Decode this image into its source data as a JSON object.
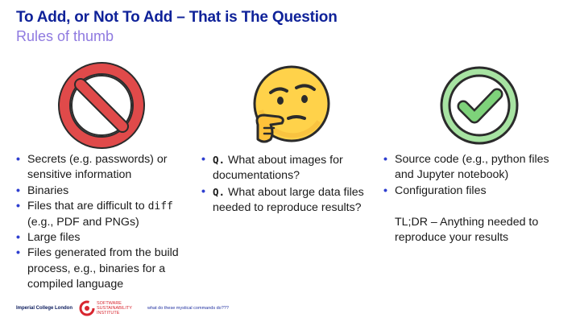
{
  "slide": {
    "title": "To Add, or Not To Add – That is The Question",
    "subtitle": "Rules of thumb"
  },
  "columns": {
    "dont_add": {
      "icon": "prohibited-icon",
      "items": [
        {
          "text": "Secrets (e.g. passwords) or sensitive information"
        },
        {
          "text": "Binaries"
        },
        {
          "pre": "Files that are difficult to ",
          "code": "diff",
          "post": " (e.g., PDF and PNGs)"
        },
        {
          "text": "Large files"
        },
        {
          "text": "Files generated from the build process, e.g., binaries for a compiled language"
        }
      ]
    },
    "questions": {
      "icon": "thinking-face-icon",
      "items": [
        {
          "label": "Q.",
          "text": " What about images for documentations?"
        },
        {
          "label": "Q.",
          "text": " What about large data files needed to reproduce results?"
        }
      ]
    },
    "do_add": {
      "icon": "check-mark-icon",
      "items": [
        {
          "text": "Source code (e.g., python files and Jupyter notebook)"
        },
        {
          "text": "Configuration files"
        }
      ],
      "tldr": "TL;DR – Anything needed to reproduce your results"
    }
  },
  "footer": {
    "imperial": "Imperial College London",
    "ssi_line1": "SOFTWARE",
    "ssi_line2": "SUSTAINABILITY",
    "ssi_line3": "INSTITUTE",
    "caption": "what do these mystical commands do???"
  },
  "colors": {
    "title": "#0f2299",
    "subtitle": "#8f7ae0",
    "bullet": "#2f3fd0",
    "prohibited_red": "#e04a4a",
    "check_green": "#7ed27a"
  }
}
